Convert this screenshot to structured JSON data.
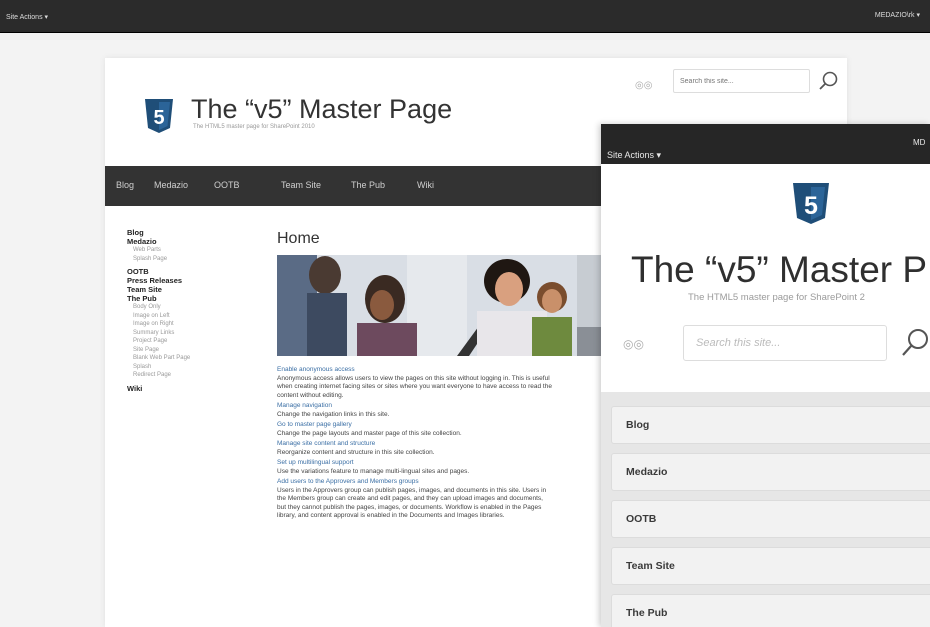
{
  "topbar": {
    "site_actions": "Site Actions ▾",
    "user_menu": "MEDAZIO\\rk ▾"
  },
  "header": {
    "title": "The “v5” Master Page",
    "subtitle": "The HTML5 master page for SharePoint 2010",
    "search_placeholder": "Search this site..."
  },
  "nav": {
    "items": [
      "Blog",
      "Medazio",
      "OOTB",
      "Team Site",
      "The Pub",
      "Wiki"
    ]
  },
  "leftnav": {
    "blog": "Blog",
    "medazio": "Medazio",
    "medazio_sub": [
      "Web Parts",
      "Splash Page"
    ],
    "ootb": "OOTB",
    "press": "Press Releases",
    "team": "Team Site",
    "pub": "The Pub",
    "pub_sub": [
      "Body Only",
      "Image on Left",
      "Image on Right",
      "Summary Links",
      "Project Page",
      "Site Page",
      "Blank Web Part Page",
      "Splash",
      "Redirect Page"
    ],
    "wiki": "Wiki"
  },
  "content": {
    "title": "Home",
    "links": [
      {
        "title": "Enable anonymous access",
        "desc": "Anonymous access allows users to view the pages on this site without logging in. This is useful when creating internet facing sites or sites where you want everyone to have access to read the content without editing."
      },
      {
        "title": "Manage navigation",
        "desc": "Change the navigation links in this site."
      },
      {
        "title": "Go to master page gallery",
        "desc": "Change the page layouts and master page of this site collection."
      },
      {
        "title": "Manage site content and structure",
        "desc": "Reorganize content and structure in this site collection."
      },
      {
        "title": "Set up multilingual support",
        "desc": "Use the variations feature to manage multi-lingual sites and pages."
      },
      {
        "title": "Add users to the Approvers and Members groups",
        "desc": "Users in the Approvers group can publish pages, images, and documents in this site. Users in the Members group can create and edit pages, and they can upload images and documents, but they cannot publish the pages, images, or documents. Workflow is enabled in the Pages library, and content approval is enabled in the Documents and Images libraries."
      }
    ]
  },
  "mobile": {
    "site_actions": "Site Actions ▾",
    "user": "MD",
    "title": "The “v5” Master P",
    "subtitle": "The HTML5 master page for SharePoint 2",
    "search_placeholder": "Search this site...",
    "nav": [
      "Blog",
      "Medazio",
      "OOTB",
      "Team Site",
      "The Pub"
    ]
  },
  "colors": {
    "accent": "#1f4e78",
    "link": "#3b6fa5",
    "dark_bar": "#333333"
  },
  "icons": {
    "logo": "html5-shield-icon",
    "search": "search-icon",
    "social": "social-icons"
  }
}
